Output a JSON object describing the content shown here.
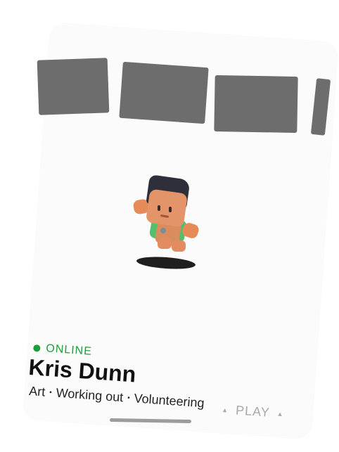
{
  "profile": {
    "status": "ONLINE",
    "name": "Kris Dunn",
    "interests": [
      "Art",
      "Working out",
      "Volunteering"
    ],
    "interest_separator": "•"
  },
  "actions": {
    "play_label": "PLAY",
    "play_marker": "▲"
  },
  "colors": {
    "online": "#1f9d3b",
    "tile": "#6d6d6d",
    "play_text": "#a8a8a8"
  },
  "icons": {
    "status": "online-dot-icon",
    "play": "triangle-icon"
  }
}
